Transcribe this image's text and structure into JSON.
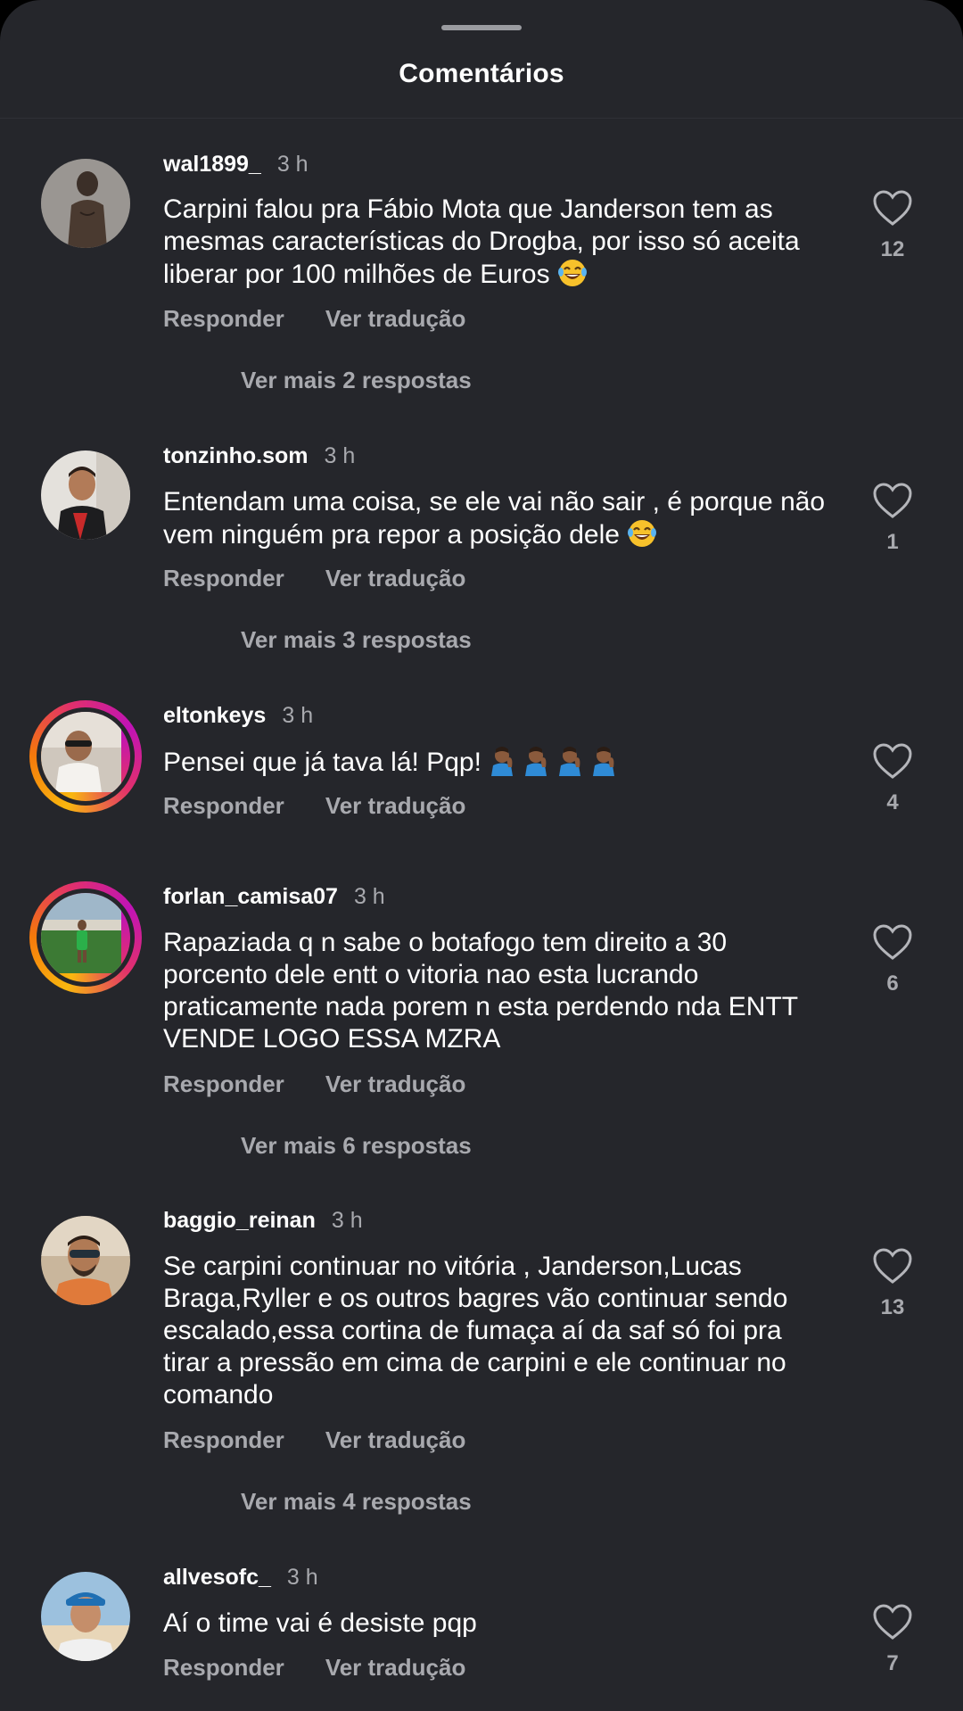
{
  "sheet": {
    "title": "Comentários"
  },
  "labels": {
    "reply": "Responder",
    "translate": "Ver tradução"
  },
  "comments": [
    {
      "username": "wal1899_",
      "time": "3 h",
      "text": "Carpini falou pra Fábio Mota que Janderson tem as mesmas características do Drogba, por isso só aceita liberar por 100 milhões de Euros",
      "emoji": "laughing-tears",
      "likes": "12",
      "replies": "Ver mais 2 respostas",
      "story_ring": false,
      "avatar_color": "#6d6a66"
    },
    {
      "username": "tonzinho.som",
      "time": "3 h",
      "text": "Entendam uma coisa, se ele vai não sair , é porque não vem ninguém pra repor a posição dele",
      "emoji": "laughing-tears",
      "likes": "1",
      "replies": "Ver mais 3 respostas",
      "story_ring": false,
      "avatar_color": "#c9c4be"
    },
    {
      "username": "eltonkeys",
      "time": "3 h",
      "text": "Pensei que já tava lá! Pqp!",
      "emoji": "facepalm-x4",
      "likes": "4",
      "replies": "",
      "story_ring": true,
      "avatar_color": "#b9b2a8"
    },
    {
      "username": "forlan_camisa07",
      "time": "3 h",
      "text": "Rapaziada q n sabe o botafogo tem direito a 30 porcento dele entt o vitoria nao esta lucrando praticamente nada porem n esta perdendo nda ENTT VENDE LOGO ESSA MZRA",
      "emoji": "",
      "likes": "6",
      "replies": "Ver mais 6 respostas",
      "story_ring": true,
      "avatar_color": "#3f7a3a"
    },
    {
      "username": "baggio_reinan",
      "time": "3 h",
      "text": "Se carpini continuar no vitória , Janderson,Lucas Braga,Ryller e os outros bagres vão continuar sendo escalado,essa cortina de fumaça aí da saf só foi pra tirar a pressão em cima de carpini e ele continuar no comando",
      "emoji": "",
      "likes": "13",
      "replies": "Ver mais 4 respostas",
      "story_ring": false,
      "avatar_color": "#8a6c55"
    },
    {
      "username": "allvesofc_",
      "time": "3 h",
      "text": "Aí o time vai é desiste pqp",
      "emoji": "",
      "likes": "7",
      "replies": "",
      "story_ring": false,
      "avatar_color": "#6f9bbd"
    }
  ]
}
